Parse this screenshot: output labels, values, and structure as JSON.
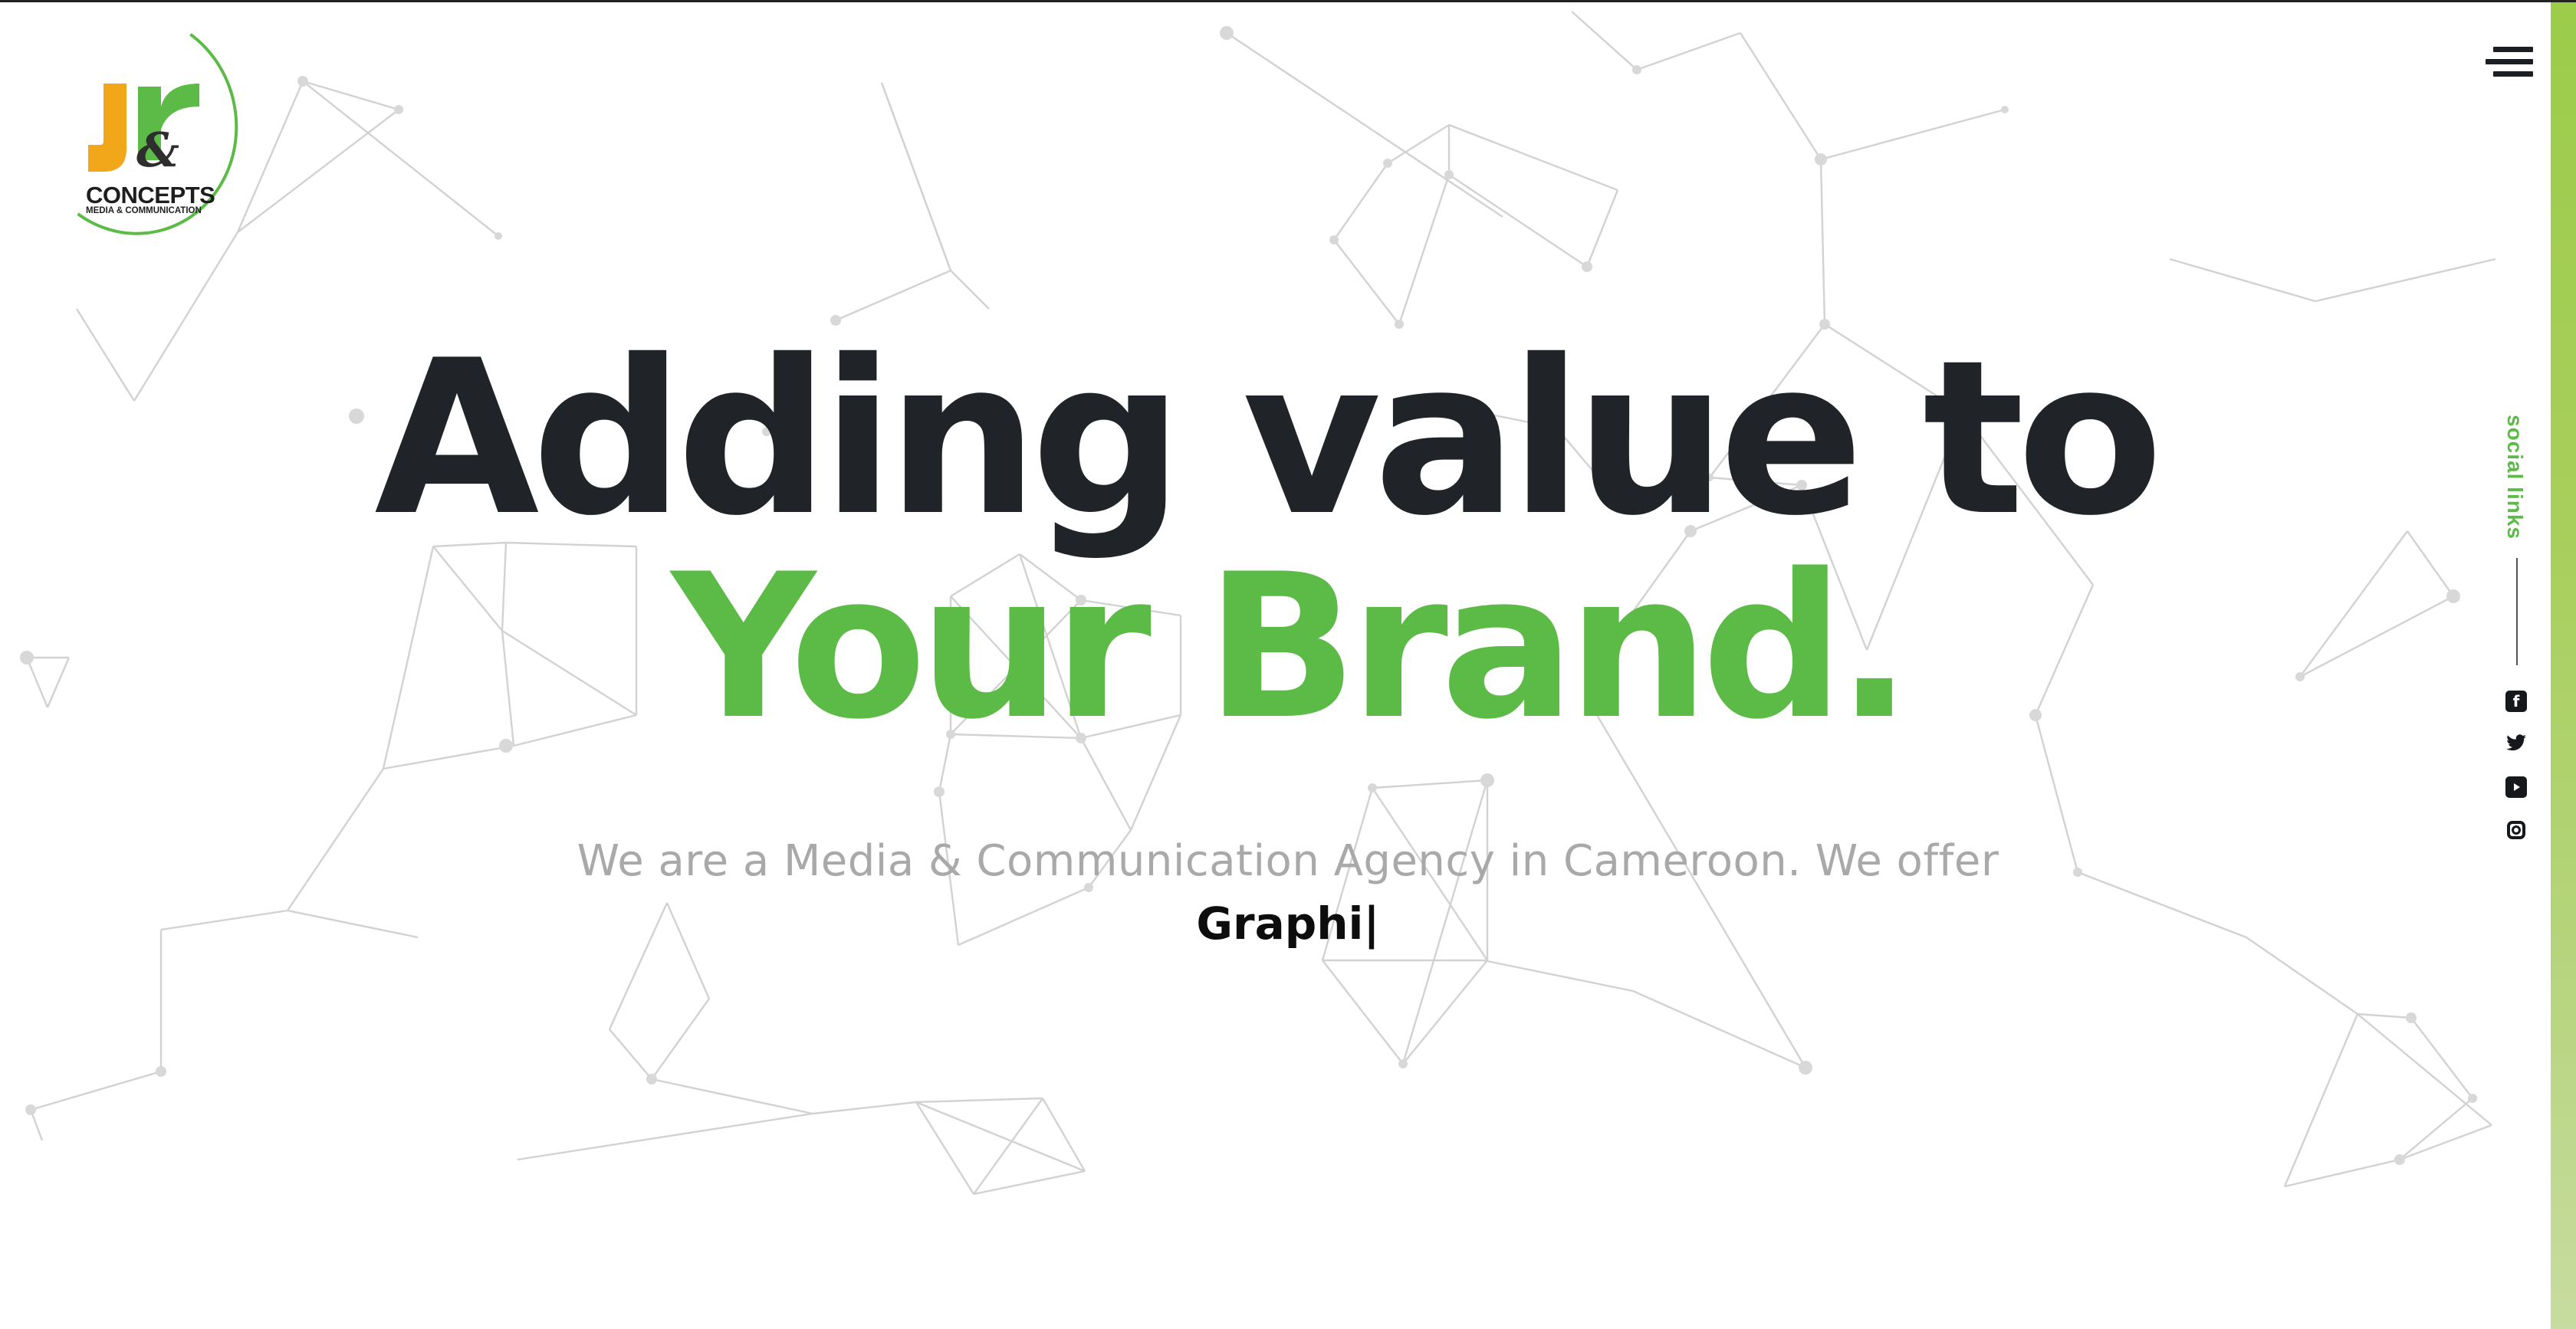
{
  "brand": {
    "logo_name": "CONCEPTS",
    "logo_subtitle": "MEDIA & COMMUNICATION",
    "logo_icon": "jr-concepts-logo",
    "colors": {
      "green": "#5cbb46",
      "orange": "#f2a71b",
      "dark": "#202328"
    }
  },
  "header": {
    "menu_icon": "hamburger-menu-icon"
  },
  "hero": {
    "headline_line1": "Adding value to",
    "headline_line2": "Your Brand.",
    "tagline": "We are a Media & Communication Agency in Cameroon. We offer",
    "typed_text": "Graphi|"
  },
  "social": {
    "label": "social links",
    "icons": [
      "facebook-icon",
      "twitter-icon",
      "youtube-icon",
      "instagram-icon"
    ]
  }
}
